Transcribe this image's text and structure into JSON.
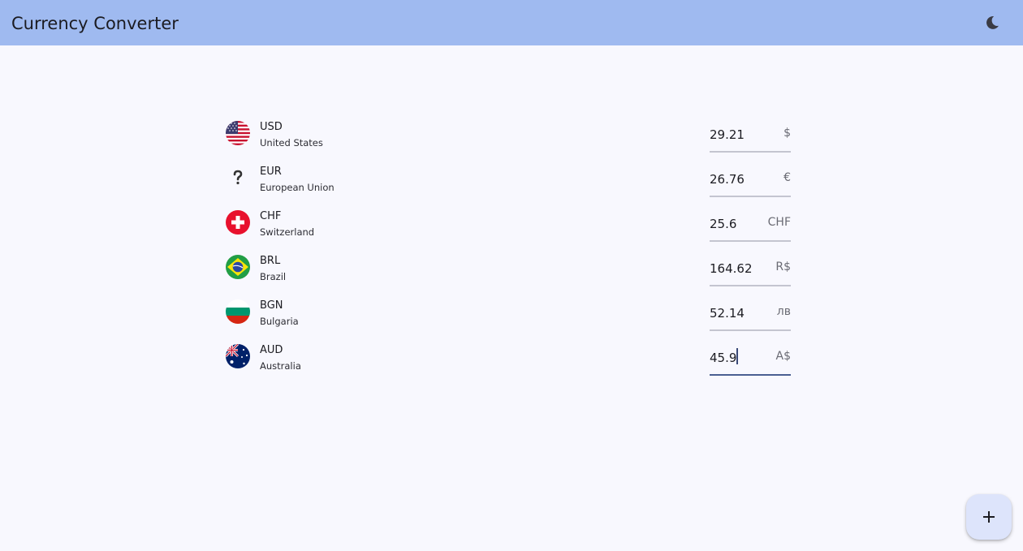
{
  "app_bar": {
    "title": "Currency Converter",
    "theme_icon": "moon-icon"
  },
  "currencies": [
    {
      "code": "USD",
      "country": "United States",
      "value": "29.21",
      "symbol": "$",
      "flag_icon": "us-flag-icon"
    },
    {
      "code": "EUR",
      "country": "European Union",
      "value": "26.76",
      "symbol": "€",
      "flag_icon": "question-mark-icon"
    },
    {
      "code": "CHF",
      "country": "Switzerland",
      "value": "25.6",
      "symbol": "CHF",
      "flag_icon": "switzerland-flag-icon"
    },
    {
      "code": "BRL",
      "country": "Brazil",
      "value": "164.62",
      "symbol": "R$",
      "flag_icon": "brazil-flag-icon"
    },
    {
      "code": "BGN",
      "country": "Bulgaria",
      "value": "52.14",
      "symbol": "лв",
      "flag_icon": "bulgaria-flag-icon"
    },
    {
      "code": "AUD",
      "country": "Australia",
      "value": "45.9",
      "symbol": "A$",
      "flag_icon": "australia-flag-icon"
    }
  ],
  "fab": {
    "icon": "plus-icon"
  },
  "colors": {
    "app_bar": "#9fbaf0",
    "background": "#f8f8fe",
    "active_underline": "#4a5f92",
    "fab": "#dde4fb"
  }
}
